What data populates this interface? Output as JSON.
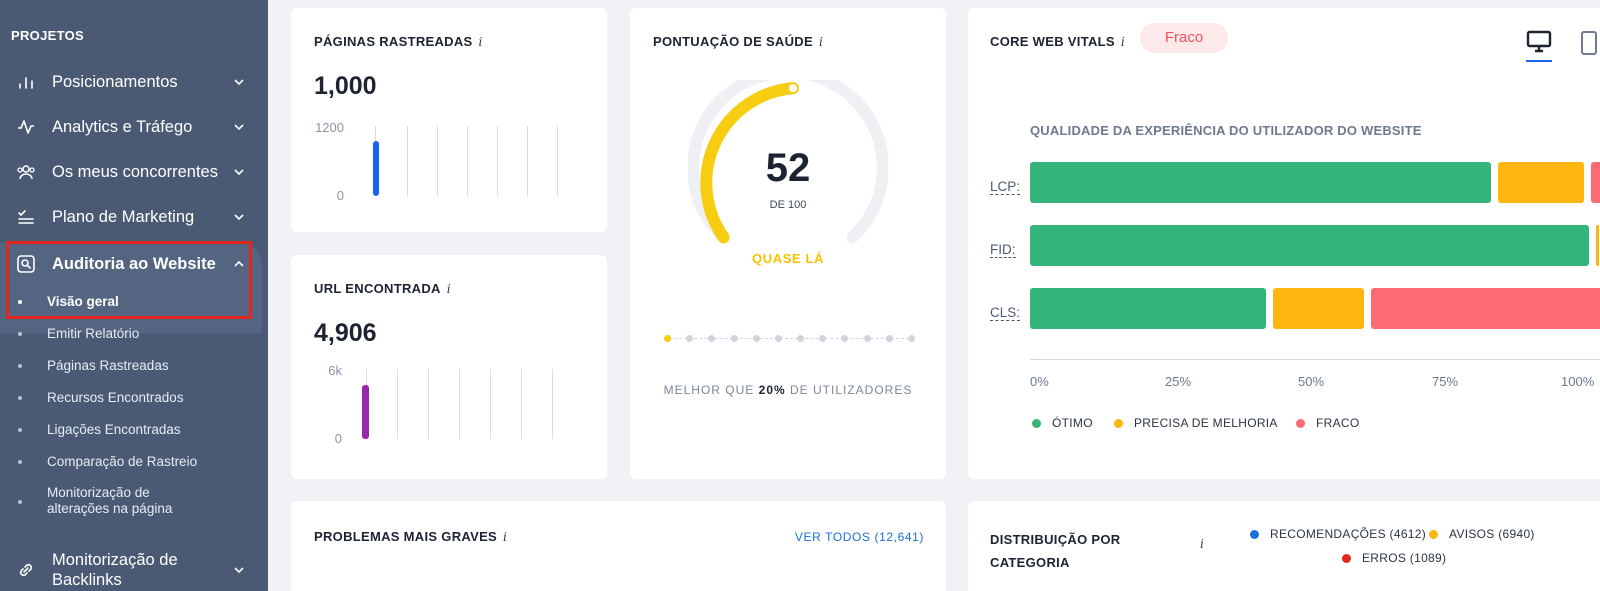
{
  "sidebar": {
    "section_title": "PROJETOS",
    "items": [
      {
        "label": "Posicionamentos",
        "icon": "bar-chart-icon"
      },
      {
        "label": "Analytics e Tráfego",
        "icon": "activity-icon"
      },
      {
        "label": "Os meus concorrentes",
        "icon": "users-icon"
      },
      {
        "label": "Plano de Marketing",
        "icon": "checklist-icon"
      },
      {
        "label": "Auditoria ao Website",
        "icon": "site-audit-icon"
      }
    ],
    "subitems": [
      {
        "label": "Visão geral"
      },
      {
        "label": "Emitir Relatório"
      },
      {
        "label": "Páginas Rastreadas"
      },
      {
        "label": "Recursos Encontrados"
      },
      {
        "label": "Ligações Encontradas"
      },
      {
        "label": "Comparação de Rastreio"
      },
      {
        "label_line1": "Monitorização de",
        "label_line2": "alterações na página"
      }
    ],
    "backlinks": {
      "line1": "Monitorização de",
      "line2": "Backlinks",
      "icon": "link-icon"
    }
  },
  "crawled": {
    "title": "PÁGINAS RASTREADAS",
    "info": "i",
    "value": "1,000",
    "axis_top": "1200",
    "axis_bottom": "0",
    "bar_level": 0.69,
    "bar_color": "#1a62f2"
  },
  "urls": {
    "title": "URL ENCONTRADA",
    "info": "i",
    "value": "4,906",
    "axis_top": "6k",
    "axis_bottom": "0",
    "bar_level": 0.82,
    "bar_color": "#9b27b0"
  },
  "health": {
    "title": "PONTUAÇÃO DE SAÚDE",
    "info": "i",
    "score": "52",
    "score_sub": "DE 100",
    "status": "QUASE LÁ",
    "status_color": "#f5c400",
    "better_prefix": "MELHOR QUE ",
    "better_value": "20%",
    "better_suffix": " DE UTILIZADORES",
    "progress_dots": 12,
    "active_dot": 0
  },
  "cwv": {
    "title": "CORE WEB VITALS",
    "info": "i",
    "badge": "Fraco",
    "chart_data": {
      "type": "bar",
      "title": "QUALIDADE DA EXPERIÊNCIA DO UTILIZADOR DO WEBSITE",
      "categories": [
        "LCP:",
        "FID:",
        "CLS:"
      ],
      "series": [
        {
          "name": "ÓTIMO",
          "color": "#35b57a",
          "values": [
            81,
            98,
            42
          ]
        },
        {
          "name": "PRECISA DE MELHORIA",
          "color": "#fdb50f",
          "values": [
            16,
            1.5,
            17
          ]
        },
        {
          "name": "FRACO",
          "color": "#fd6a73",
          "values": [
            10,
            0.5,
            47
          ]
        }
      ],
      "xticks": [
        "0%",
        "25%",
        "50%",
        "75%",
        "100%"
      ],
      "xlim": [
        0,
        100
      ],
      "legend": "bottom"
    }
  },
  "problems": {
    "title": "PROBLEMAS MAIS GRAVES",
    "info": "i",
    "link": "VER TODOS (12,641)"
  },
  "distribution": {
    "title_line1": "DISTRIBUIÇÃO POR",
    "title_line2": "CATEGORIA",
    "info": "i",
    "legend": [
      {
        "label": "RECOMENDAÇÕES (4612)",
        "color": "#1a6fd9"
      },
      {
        "label": "AVISOS (6940)",
        "color": "#fdb50f"
      },
      {
        "label": "ERROS (1089)",
        "color": "#e3261d"
      }
    ]
  },
  "colors": {
    "sidebar": "#4a5a74",
    "accent": "#1a62f2",
    "highlight_box": "#e3261d",
    "link": "#1a6fd9"
  }
}
